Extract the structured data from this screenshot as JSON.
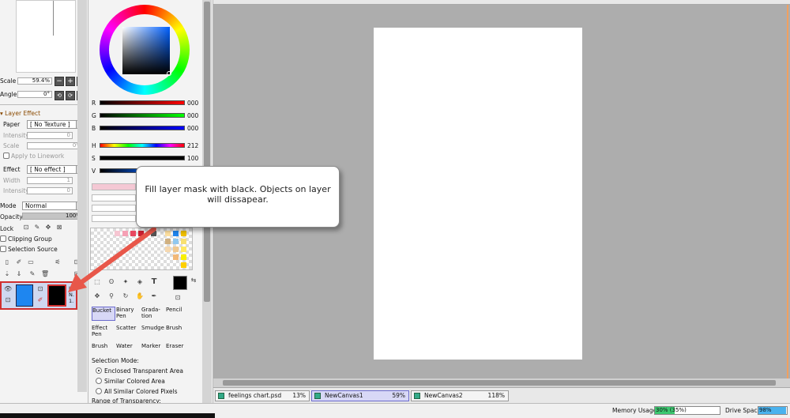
{
  "left_panel": {
    "scale_label": "Scale",
    "scale_value": "59.4%",
    "angle_label": "Angle",
    "angle_value": "0°",
    "zoom_btn_minus": "−",
    "zoom_btn_plus": "+",
    "layer_effect_label": "Layer Effect",
    "paper_label": "Paper",
    "paper_value": "[ No Texture ]",
    "intensity_label": "Intensity",
    "intensity_value": "0",
    "scale2_label": "Scale",
    "scale2_value": "0%",
    "apply_linework_label": "Apply to Linework",
    "effect_label": "Effect",
    "effect_value": "[ No effect ]",
    "width_label": "Width",
    "width_value": "1",
    "intensity2_label": "Intensity",
    "intensity2_value": "0",
    "mode_label": "Mode",
    "mode_value": "Normal",
    "opacity_label": "Opacity",
    "opacity_value": "100%",
    "lock_label": "Lock",
    "clipping_label": "Clipping Group",
    "selection_source_label": "Selection Source",
    "layer_name_short": "L. N. 1."
  },
  "color_panel": {
    "r_label": "R",
    "r_value": "000",
    "g_label": "G",
    "g_value": "000",
    "b_label": "B",
    "b_value": "000",
    "h_label": "H",
    "h_value": "212",
    "s_label": "S",
    "s_value": "100",
    "v_label": "V"
  },
  "tools": {
    "bucket": "Bucket",
    "binary_pen": "Binary Pen",
    "gradation": "Grada-tion",
    "pencil": "Pencil",
    "effect_pen": "Effect Pen",
    "scatter": "Scatter",
    "smudge": "Smudge",
    "brush": "Brush",
    "brush2": "Brush",
    "water": "Water",
    "marker": "Marker",
    "eraser": "Eraser"
  },
  "selection": {
    "title": "Selection Mode:",
    "opt1": "Enclosed Transparent Area",
    "opt2": "Similar Colored Area",
    "opt3": "All Similar Colored Pixels",
    "range_label": "Range of Transparency:"
  },
  "callout": {
    "text": "Fill layer mask with black. Objects on layer will dissapear."
  },
  "tabs": [
    {
      "name": "feelings chart.psd",
      "zoom": "13%"
    },
    {
      "name": "NewCanvas1",
      "zoom": "59%"
    },
    {
      "name": "NewCanvas2",
      "zoom": "118%"
    }
  ],
  "status": {
    "memory_label": "Memory Usage",
    "memory_value": "30% (35%)",
    "memory_fraction": 0.3,
    "drive_label": "Drive Space",
    "drive_value": "98%",
    "drive_fraction": 0.98
  },
  "colors": {
    "accent": "#6a6acc",
    "arrow": "#e8574a",
    "highlight_box": "#d03030"
  }
}
